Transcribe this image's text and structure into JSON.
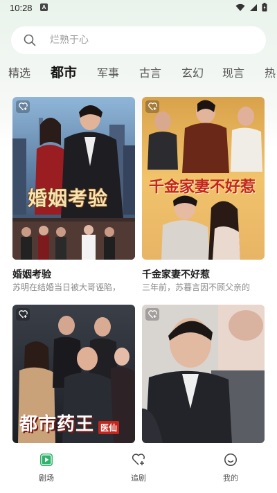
{
  "status_bar": {
    "time": "10:28",
    "notification_badge": "A"
  },
  "search": {
    "placeholder": "烂熟于心"
  },
  "tabs": [
    {
      "label": "精选",
      "active": false
    },
    {
      "label": "都市",
      "active": true
    },
    {
      "label": "军事",
      "active": false
    },
    {
      "label": "古言",
      "active": false
    },
    {
      "label": "玄幻",
      "active": false
    },
    {
      "label": "现言",
      "active": false
    },
    {
      "label": "热",
      "active": false
    }
  ],
  "cards": [
    {
      "title": "婚姻考验",
      "desc": "苏明在结婚当日被大哥诬陷，",
      "poster_text": "婚姻考验"
    },
    {
      "title": "千金家妻不好惹",
      "desc": "三年前，苏暮言因不顾父亲的",
      "poster_text": "千金家妻不好惹"
    },
    {
      "title": "",
      "desc": "",
      "poster_text": "都市药王",
      "poster_badge": "医仙"
    },
    {
      "title": "",
      "desc": "",
      "poster_text": ""
    }
  ],
  "bottom_nav": [
    {
      "label": "剧场",
      "icon": "play-square-icon",
      "active": true
    },
    {
      "label": "追剧",
      "icon": "heart-plus-icon",
      "active": false
    },
    {
      "label": "我的",
      "icon": "smile-icon",
      "active": false
    }
  ],
  "colors": {
    "accent": "#2db36a",
    "background_tint": "#e9f3ec"
  }
}
